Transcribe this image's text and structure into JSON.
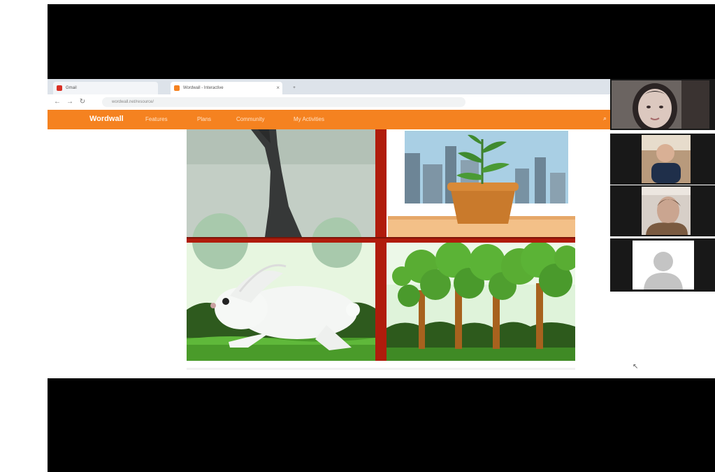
{
  "browser": {
    "tabs": [
      {
        "label": "Gmail",
        "favicon_color": "#d93025"
      },
      {
        "label": "Wordwall - Interactive",
        "favicon_color": "#f58220"
      }
    ],
    "new_tab_label": "+",
    "url": "wordwall.net/resource/",
    "nav": {
      "back": "←",
      "forward": "→",
      "reload": "↻"
    }
  },
  "website": {
    "brand": "Wordwall",
    "menu": [
      "Features",
      "Plans",
      "Community",
      "My Activities"
    ],
    "accent_color": "#f58220"
  },
  "slide": {
    "quadrants": [
      "tree-trunk",
      "potted-plant",
      "rabbit",
      "forest"
    ],
    "divider_color": "#b01c0c"
  },
  "participants": [
    {
      "name": "participant-1",
      "kind": "video"
    },
    {
      "name": "participant-2",
      "kind": "video"
    },
    {
      "name": "participant-3",
      "kind": "video"
    },
    {
      "name": "participant-4",
      "kind": "avatar"
    }
  ]
}
